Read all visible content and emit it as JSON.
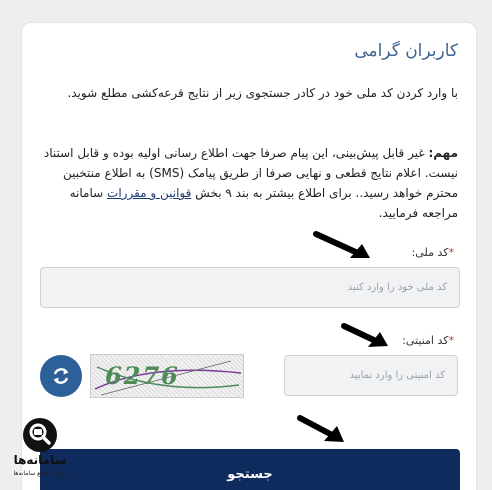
{
  "card": {
    "title": "کاربران گرامی",
    "intro": "با وارد کردن کد ملی خود در کادر جستجوی زیر از نتایج قرعه‌کشی مطلع شوید.",
    "notice": {
      "label": "مهم:",
      "text": " غیر قابل پیش‌بینی، این پیام صرفا جهت اطلاع رسانی اولیه بوده و قابل استناد نیست. اعلام نتایج قطعی و نهایی صرفا از طریق پیامک (SMS) به اطلاع منتخبین محترم خواهد رسید.. برای اطلاع بیشتر به بند ۹ بخش ",
      "link": "قوانین و مقررات",
      "suffix": " سامانه مراجعه فرمایید."
    }
  },
  "form": {
    "national_id": {
      "label": "کد ملی:",
      "required_mark": "*",
      "placeholder": "کد ملی خود را وارد کنید",
      "value": ""
    },
    "security_code": {
      "label": "کد امنیتی:",
      "required_mark": "*",
      "placeholder": "کد امنیتی را وارد نمایید",
      "value": ""
    },
    "captcha_text": "6276",
    "submit_label": "جستجو"
  },
  "watermark": {
    "title": "سامانه‌ها",
    "subtitle": "پورتال جامع سامانه‌ها"
  },
  "colors": {
    "title": "#3f6493",
    "button": "#0f2a5c",
    "refresh": "#2d5f98",
    "required": "#d42a2a"
  },
  "icons": [
    "refresh-icon",
    "search-logo-icon",
    "pointer-arrow-icon"
  ]
}
